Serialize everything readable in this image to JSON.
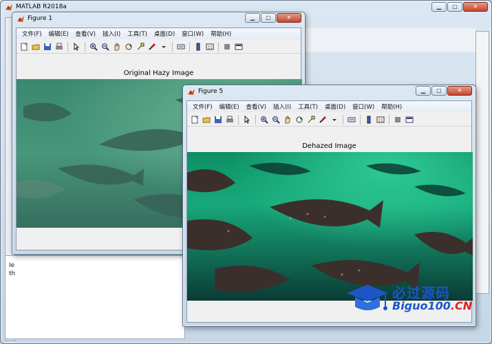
{
  "matlab": {
    "title": "MATLAB R2018a",
    "left_glyphs": [
      "Ie",
      "th"
    ]
  },
  "menus": [
    "文件(F)",
    "编辑(E)",
    "查看(V)",
    "插入(I)",
    "工具(T)",
    "桌面(D)",
    "窗口(W)",
    "帮助(H)"
  ],
  "toolbar_icons": [
    "new-figure-icon",
    "open-icon",
    "save-icon",
    "print-icon",
    "sep",
    "select-arrow-icon",
    "sep",
    "zoom-in-icon",
    "zoom-out-icon",
    "pan-hand-icon",
    "rotate-3d-icon",
    "data-cursor-icon",
    "brush-icon",
    "dropdown-arrow-icon",
    "sep",
    "link-plot-icon",
    "sep",
    "colorbar-icon",
    "legend-icon",
    "sep",
    "hide-tools-icon",
    "show-tools-icon"
  ],
  "figure1": {
    "title": "Figure 1",
    "axes_title": "Original Hazy Image"
  },
  "figure5": {
    "title": "Figure 5",
    "axes_title": "Dehazed Image"
  },
  "watermark": {
    "cn_text": "必过源码",
    "en_text": "Biguo100",
    "en_suffix": ".CN"
  },
  "colors": {
    "hazy_water": "#3f8f74",
    "clear_water": "#17a97a",
    "window_frame": "#c6d7e7",
    "watermark_blue": "#1d55c9"
  }
}
